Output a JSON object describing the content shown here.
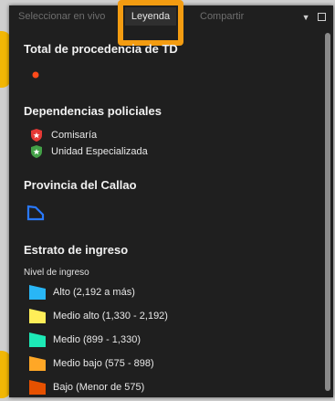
{
  "tabs": {
    "live": "Seleccionar en vivo",
    "legend": "Leyenda",
    "share": "Compartir"
  },
  "sections": {
    "total": {
      "title": "Total de procedencia de TD"
    },
    "police": {
      "title": "Dependencias policiales",
      "items": [
        {
          "label": "Comisaría",
          "icon": "shield-red-icon",
          "color": "#e53935"
        },
        {
          "label": "Unidad Especializada",
          "icon": "shield-green-icon",
          "color": "#43a047"
        }
      ]
    },
    "callao": {
      "title": "Provincia del Callao"
    },
    "income": {
      "title": "Estrato de ingreso",
      "subtitle": "Nivel de ingreso",
      "items": [
        {
          "label": "Alto (2,192 a más)",
          "color": "#29b6f6"
        },
        {
          "label": "Medio alto (1,330 - 2,192)",
          "color": "#ffee58"
        },
        {
          "label": "Medio (899 - 1,330)",
          "color": "#1de9b6"
        },
        {
          "label": "Medio bajo (575 - 898)",
          "color": "#ffa726"
        },
        {
          "label": "Bajo (Menor de 575)",
          "color": "#e65100"
        }
      ]
    }
  },
  "colors": {
    "accent": "#f39c11",
    "point": "#ff4a1a",
    "callao": "#2979ff"
  }
}
